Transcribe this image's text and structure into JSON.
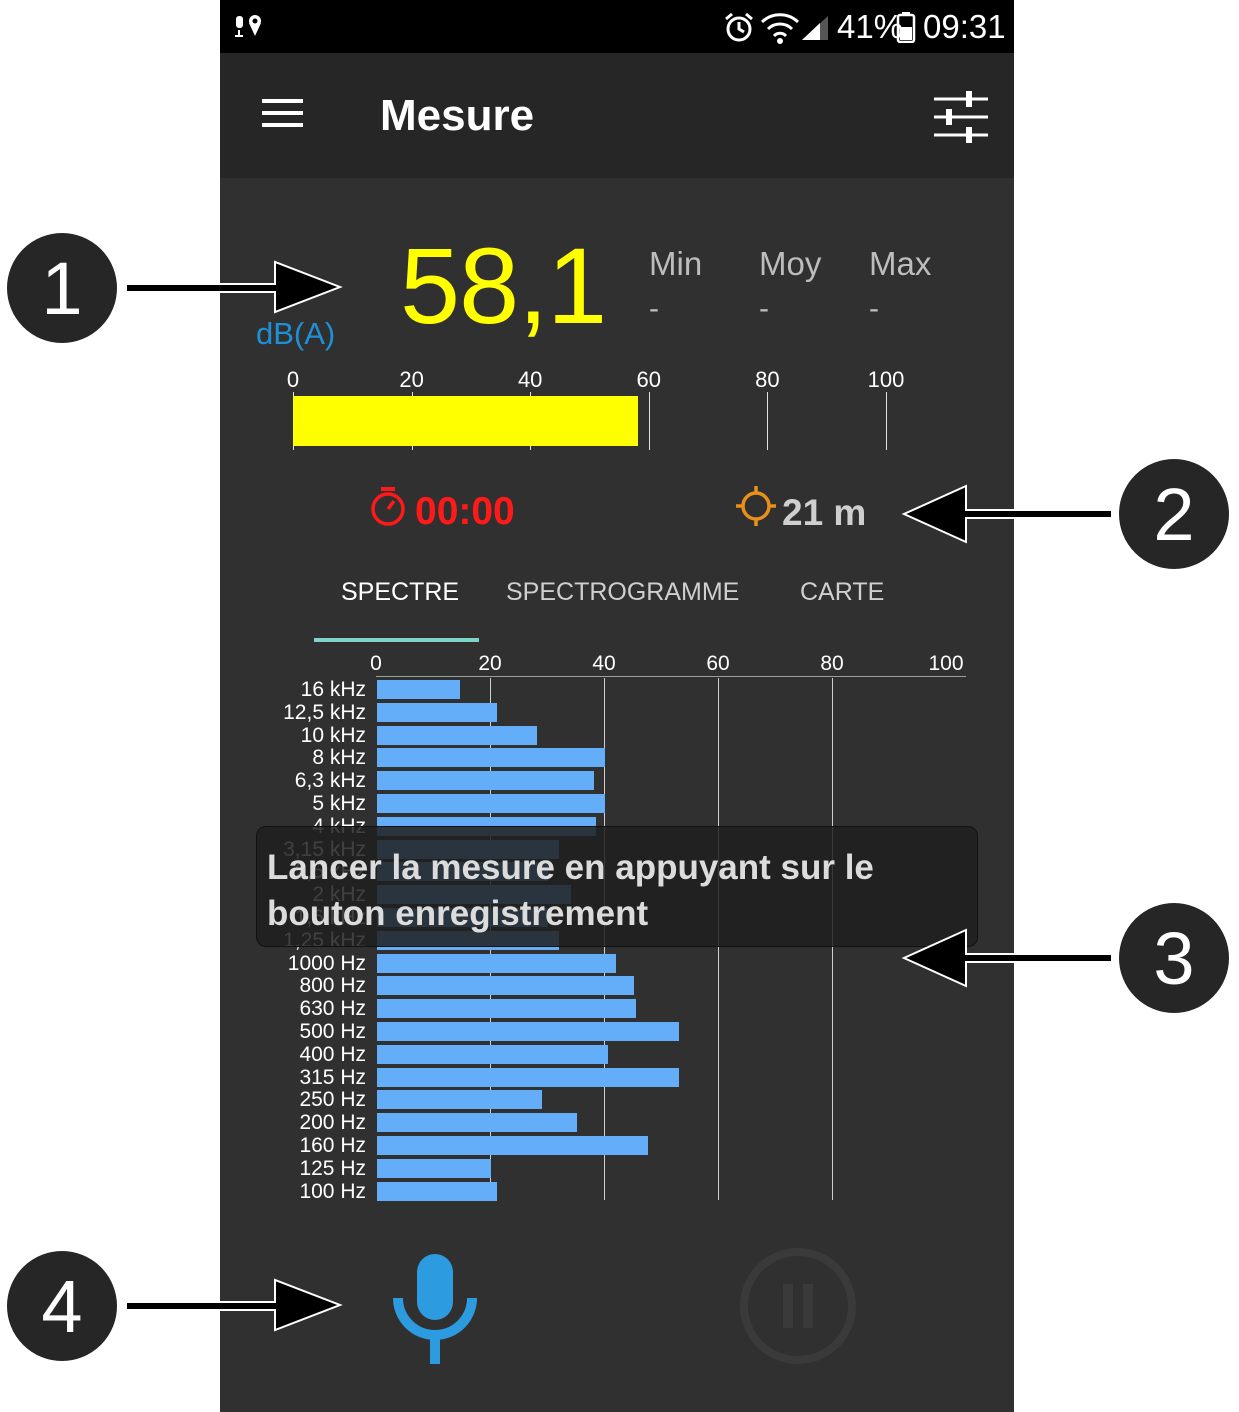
{
  "status_bar": {
    "battery": "41%",
    "time": "09:31"
  },
  "app_bar": {
    "title": "Mesure",
    "menu_icon": "hamburger-menu-icon",
    "settings_icon": "sliders-icon"
  },
  "measure": {
    "value": "58,1",
    "unit": "dB(A)",
    "level_db": 58.1,
    "stats": [
      {
        "label": "Min",
        "value": "-"
      },
      {
        "label": "Moy",
        "value": "-"
      },
      {
        "label": "Max",
        "value": "-"
      }
    ],
    "scale_labels": [
      "0",
      "20",
      "40",
      "60",
      "80",
      "100"
    ],
    "timer": "00:00",
    "gps_accuracy": "21 m",
    "colors": {
      "level": "#ffff00",
      "unit": "#1e90d6",
      "timer": "#ff1a1a",
      "gps": "#e8901a"
    }
  },
  "tabs": [
    {
      "label": "SPECTRE",
      "active": true
    },
    {
      "label": "SPECTROGRAMME",
      "active": false
    },
    {
      "label": "CARTE",
      "active": false
    }
  ],
  "chart_data": {
    "type": "bar",
    "orientation": "horizontal",
    "xlim": [
      0,
      100
    ],
    "x_ticks": [
      "0",
      "20",
      "40",
      "60",
      "80",
      "100"
    ],
    "grid": true,
    "bar_color": "#64aef9",
    "categories": [
      "16 kHz",
      "12,5 kHz",
      "10 kHz",
      "8 kHz",
      "6,3 kHz",
      "5 kHz",
      "4 kHz",
      "3,15 kHz",
      "2,5 kHz",
      "2 kHz",
      "1,6 kHz",
      "1,25 kHz",
      "1000 Hz",
      "800 Hz",
      "630 Hz",
      "500 Hz",
      "400 Hz",
      "315 Hz",
      "250 Hz",
      "200 Hz",
      "160 Hz",
      "125 Hz",
      "100 Hz"
    ],
    "values": [
      14.5,
      21,
      28,
      40,
      38,
      40,
      38.5,
      32,
      30,
      34,
      30,
      32,
      42,
      45,
      45.5,
      53,
      40.5,
      53,
      29,
      35,
      47.5,
      20,
      21
    ]
  },
  "toast": {
    "text": "Lancer la mesure en appuyant sur le bouton enregistrement"
  },
  "bottom_bar": {
    "mic_icon": "microphone-icon",
    "pause_icon": "pause-icon"
  },
  "callouts": [
    "1",
    "2",
    "3",
    "4"
  ]
}
